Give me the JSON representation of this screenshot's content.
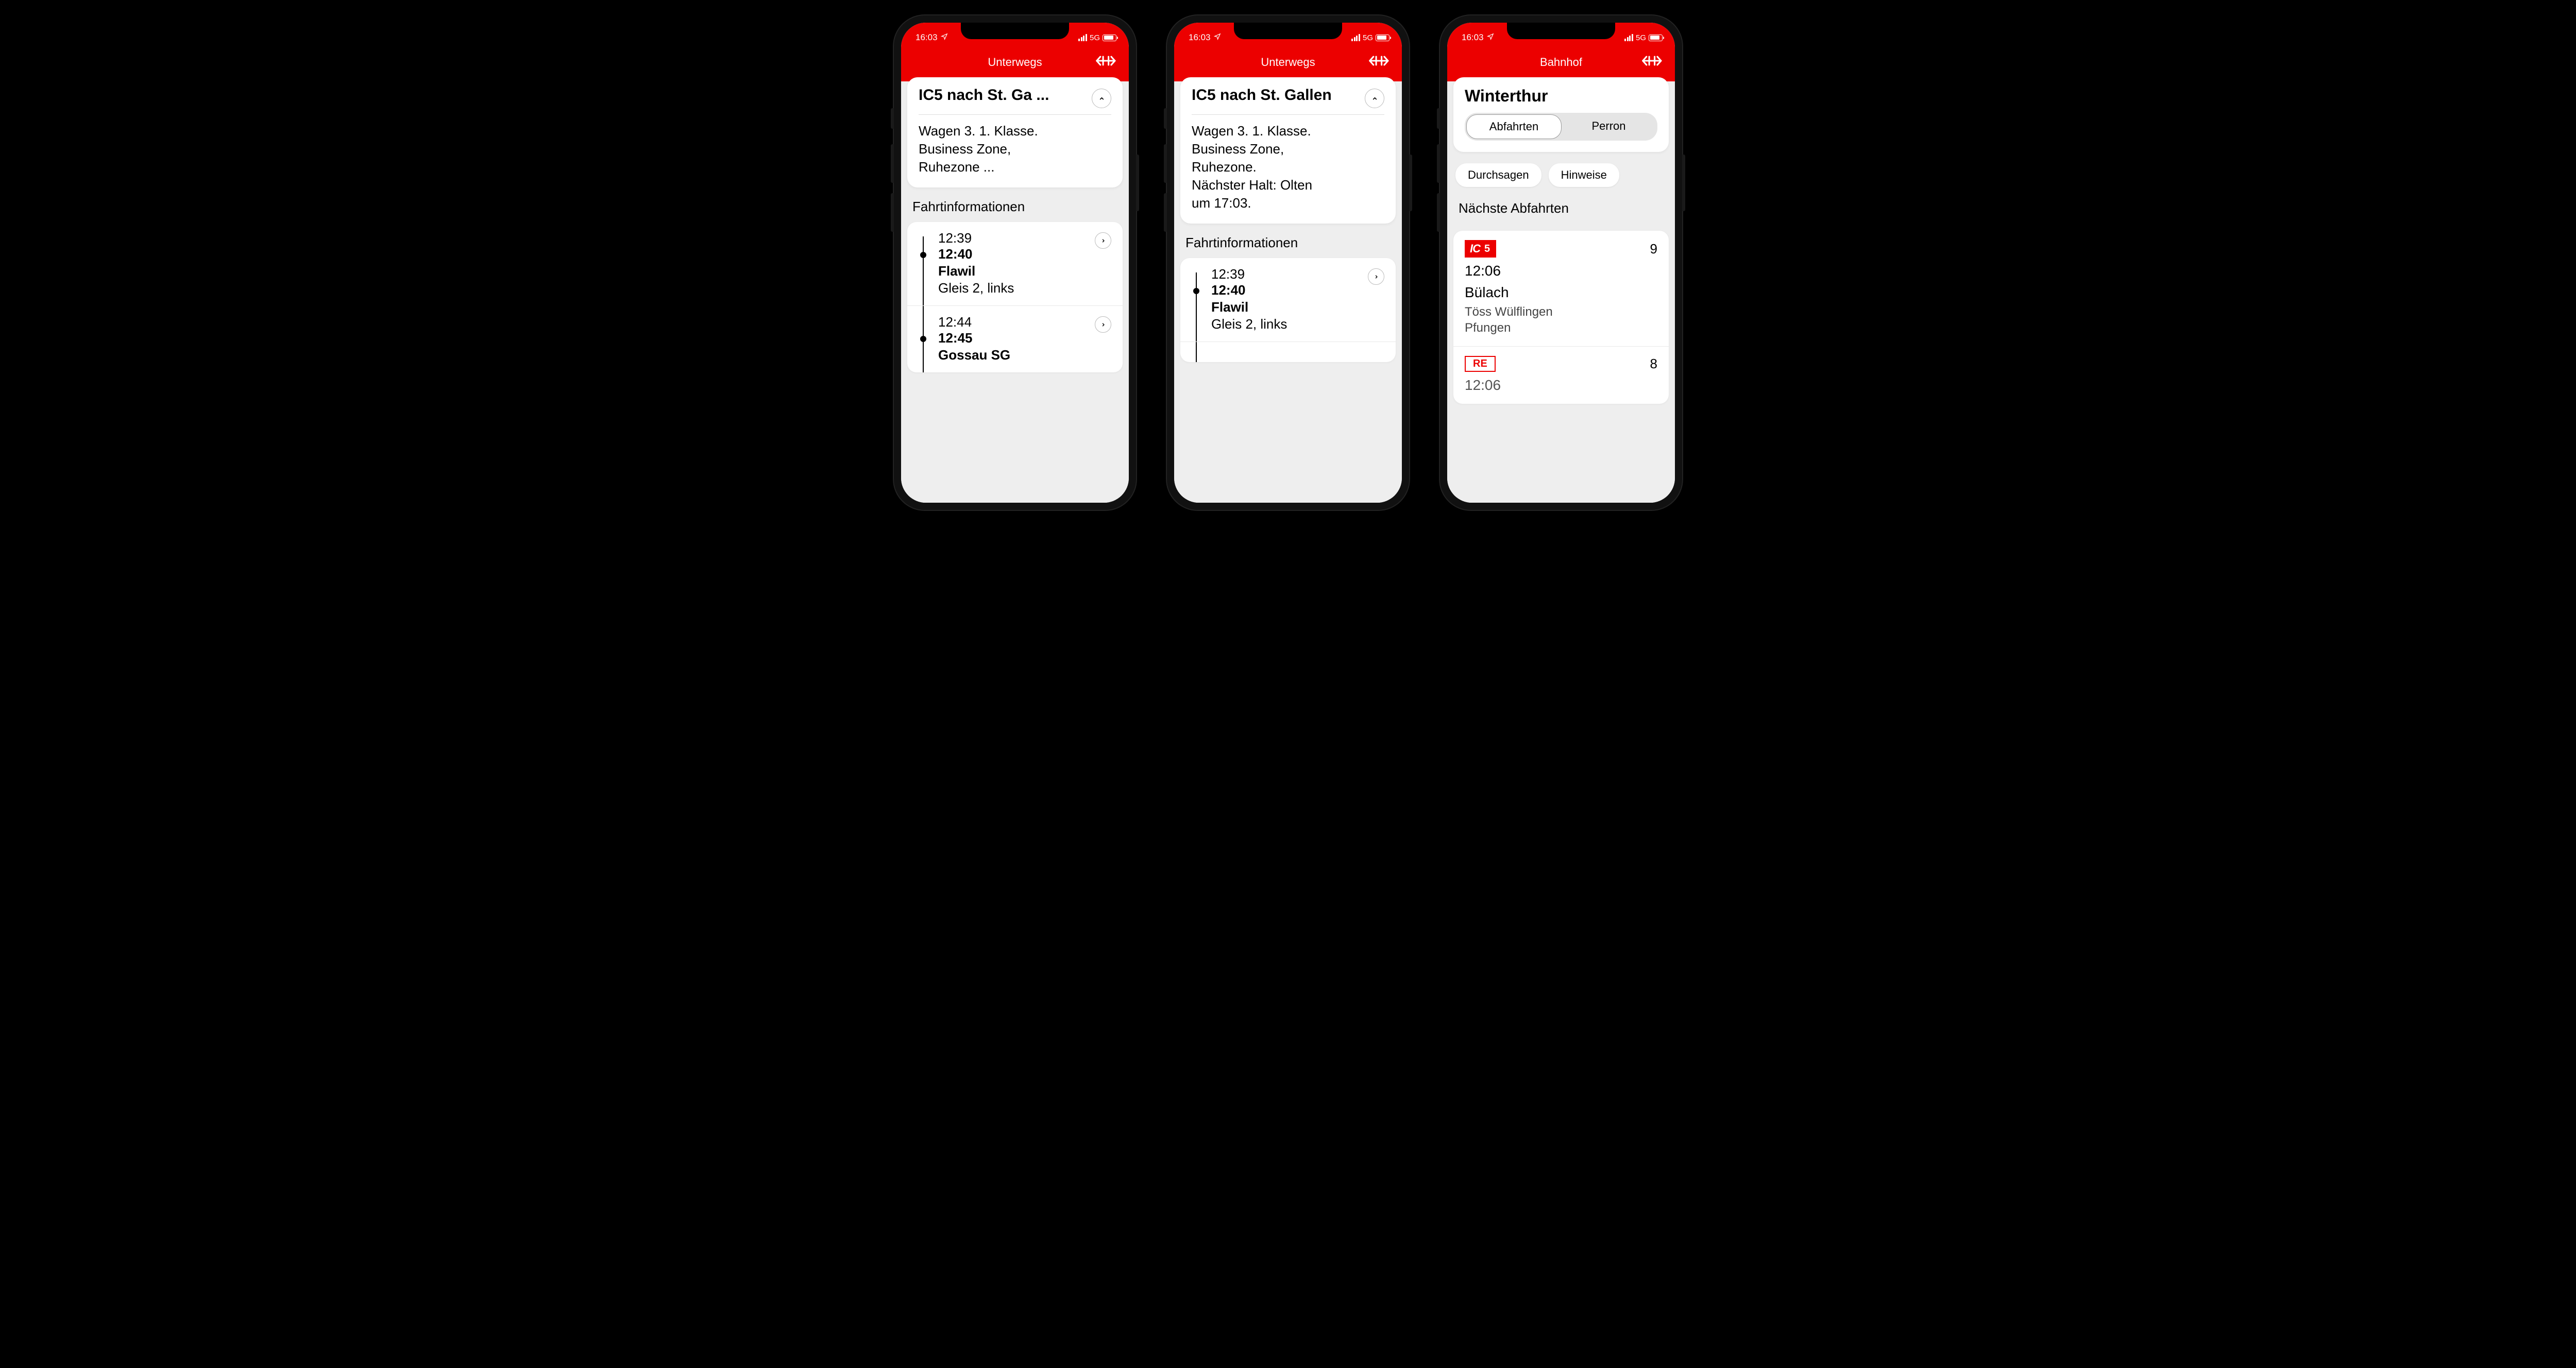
{
  "status": {
    "time": "16:03",
    "network": "5G"
  },
  "screen1": {
    "header": "Unterwegs",
    "card": {
      "title": "IC5 nach St. Ga ...",
      "body_l1": "Wagen 3. 1. Klasse.",
      "body_l2": "Business Zone,",
      "body_l3": "Ruhezone ..."
    },
    "section": "Fahrtinformationen",
    "stops": [
      {
        "arr": "12:39",
        "dep": "12:40",
        "name": "Flawil",
        "track": "Gleis 2, links"
      },
      {
        "arr": "12:44",
        "dep": "12:45",
        "name": "Gossau SG",
        "track": ""
      }
    ]
  },
  "screen2": {
    "header": "Unterwegs",
    "card": {
      "title": "IC5 nach St. Gallen",
      "body_l1": "Wagen 3. 1. Klasse.",
      "body_l2": "Business Zone,",
      "body_l3": "Ruhezone.",
      "body_l4": "Nächster Halt: Olten",
      "body_l5": "um 17:03."
    },
    "section": "Fahrtinformationen",
    "stops": [
      {
        "arr": "12:39",
        "dep": "12:40",
        "name": "Flawil",
        "track": "Gleis 2, links"
      }
    ]
  },
  "screen3": {
    "header": "Bahnhof",
    "station": "Winterthur",
    "seg": {
      "a": "Abfahrten",
      "b": "Perron"
    },
    "pills": {
      "a": "Durchsagen",
      "b": "Hinweise"
    },
    "section": "Nächste Abfahrten",
    "deps": [
      {
        "badge_type": "IC",
        "badge_num": "5",
        "platform": "9",
        "time": "12:06",
        "dest": "Bülach",
        "stops_l1": "Töss   Wülflingen",
        "stops_l2": "Pfungen"
      },
      {
        "badge_type": "RE",
        "badge_num": "",
        "platform": "8",
        "time": "12:06",
        "dest": "",
        "stops_l1": "",
        "stops_l2": ""
      }
    ]
  }
}
